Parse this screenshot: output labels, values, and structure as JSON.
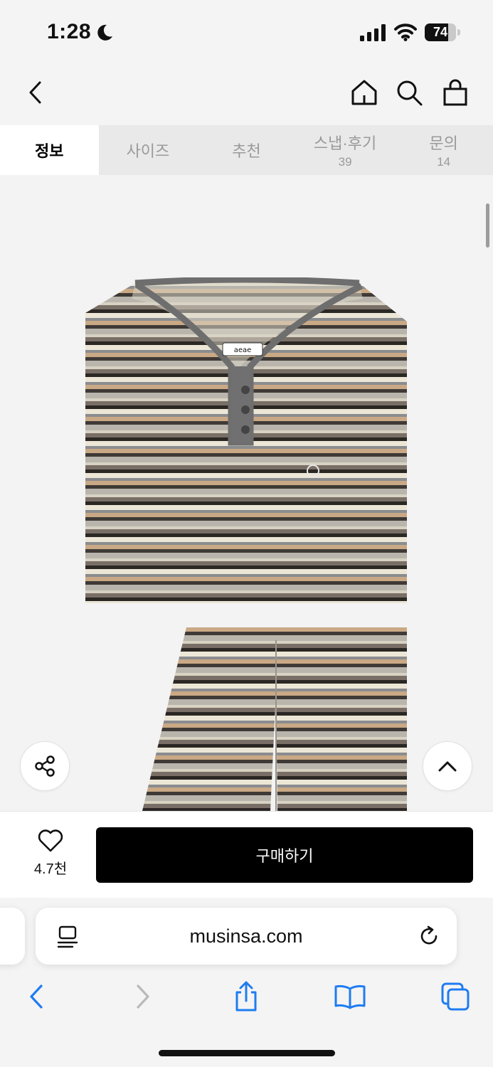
{
  "status_bar": {
    "time": "1:28",
    "battery": "74",
    "battery_level": 0.74
  },
  "tabs": [
    {
      "label": "정보",
      "count": ""
    },
    {
      "label": "사이즈",
      "count": ""
    },
    {
      "label": "추천",
      "count": ""
    },
    {
      "label": "스냅·후기",
      "count": "39"
    },
    {
      "label": "문의",
      "count": "14"
    }
  ],
  "product": {
    "label_tag": "aeae",
    "stripe_colors": [
      "#2b2724",
      "#ece6d6",
      "#8a8c8f",
      "#c9a985",
      "#3f3a36",
      "#b9b5ad",
      "#d8d2c3",
      "#7a6f66"
    ],
    "trim_color": "#6e6e6e"
  },
  "purchase": {
    "like_count": "4.7천",
    "buy_label": "구매하기"
  },
  "safari": {
    "url": "musinsa.com"
  },
  "colors": {
    "accent_blue": "#1e7cf2",
    "buy_button": "#000000"
  }
}
